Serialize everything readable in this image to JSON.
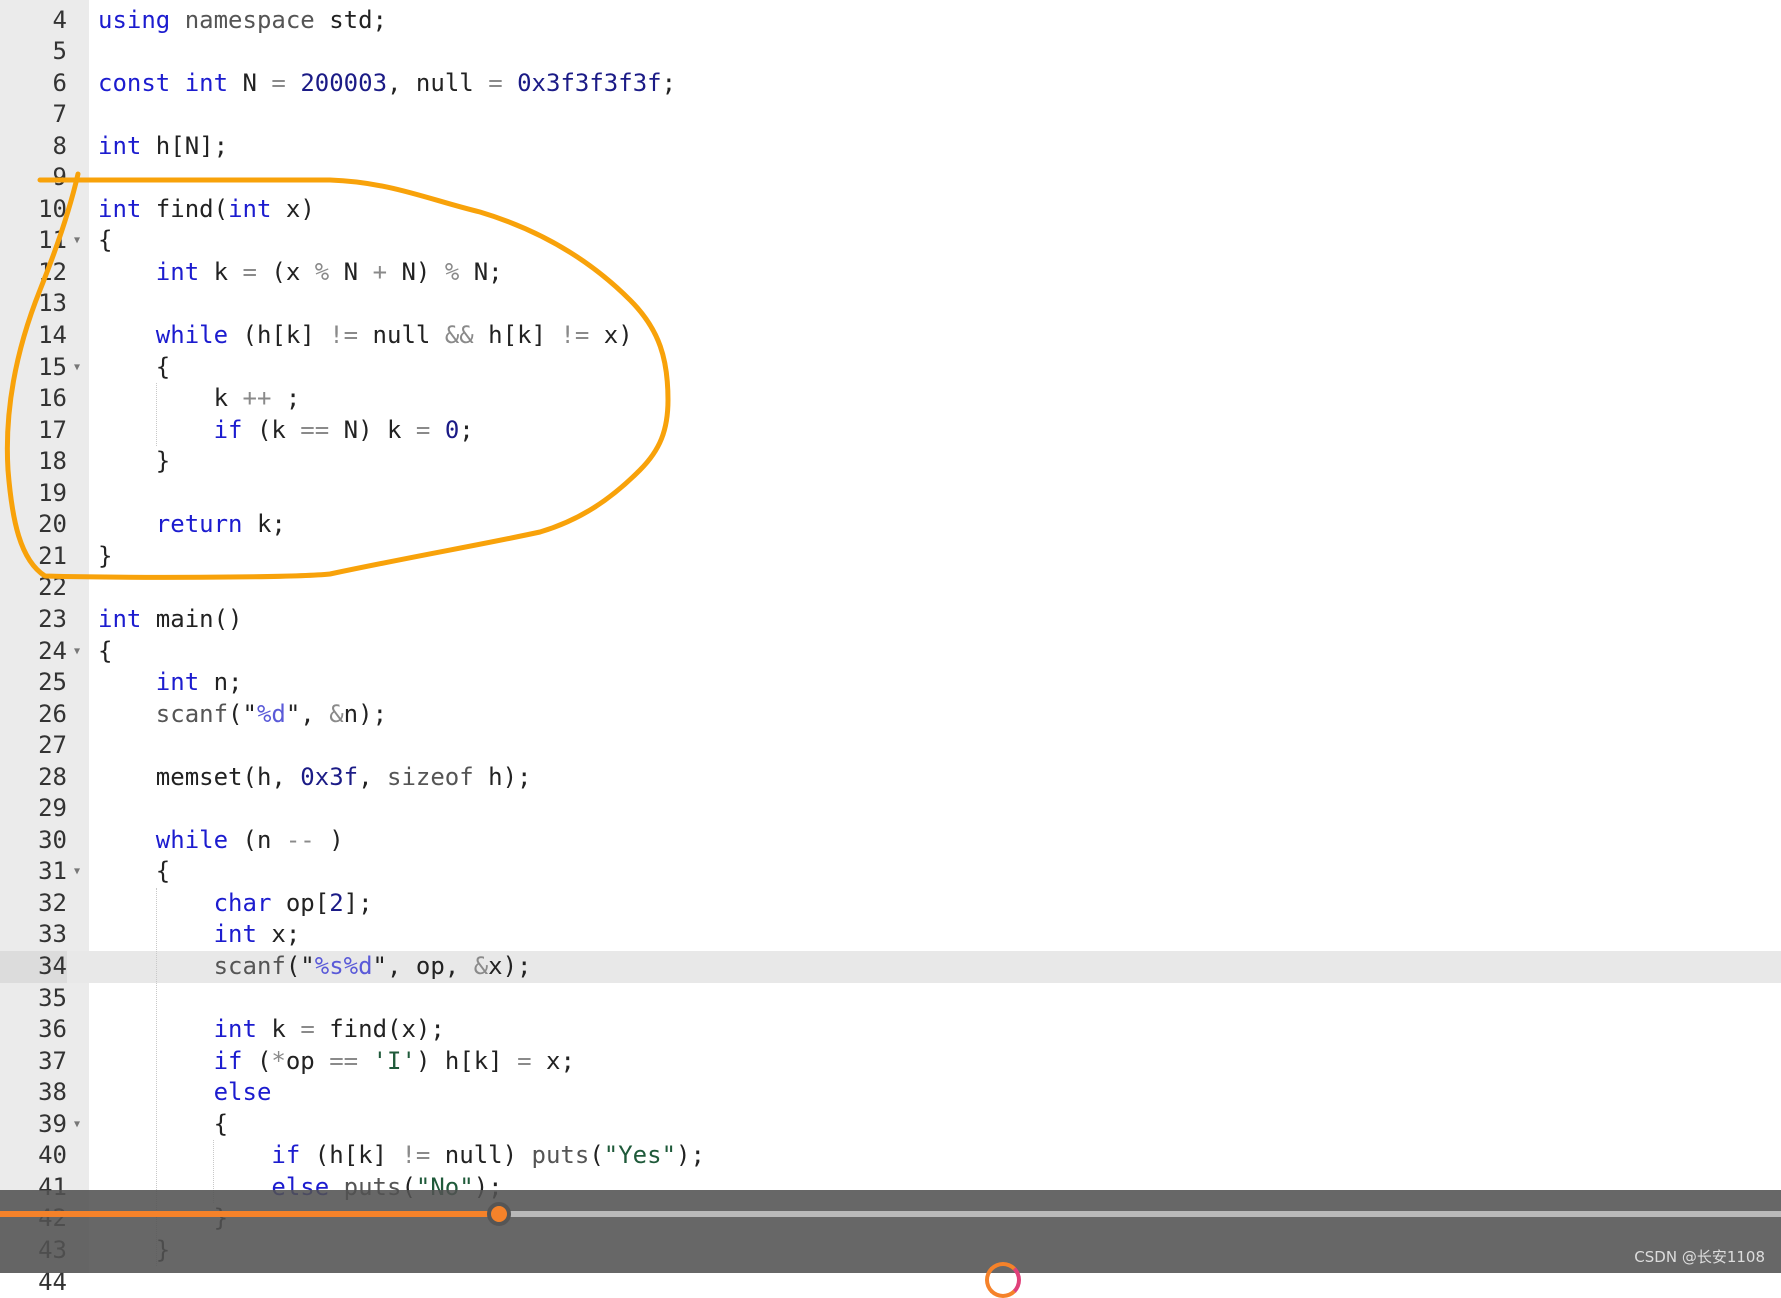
{
  "editor": {
    "active_line": 34,
    "fold_lines": [
      11,
      15,
      24,
      31,
      39
    ],
    "lines": [
      {
        "n": "4",
        "t": [
          [
            "k",
            "using"
          ],
          [
            "f",
            " namespace"
          ],
          [
            "p",
            " std;"
          ]
        ]
      },
      {
        "n": "5",
        "t": []
      },
      {
        "n": "6",
        "t": [
          [
            "k",
            "const"
          ],
          [
            "p",
            " "
          ],
          [
            "k",
            "int"
          ],
          [
            "p",
            " N "
          ],
          [
            "o",
            "="
          ],
          [
            "p",
            " "
          ],
          [
            "n",
            "200003"
          ],
          [
            "p",
            ", null "
          ],
          [
            "o",
            "="
          ],
          [
            "p",
            " "
          ],
          [
            "n",
            "0x3f3f3f3f"
          ],
          [
            "p",
            ";"
          ]
        ]
      },
      {
        "n": "7",
        "t": []
      },
      {
        "n": "8",
        "t": [
          [
            "k",
            "int"
          ],
          [
            "p",
            " h[N];"
          ]
        ]
      },
      {
        "n": "9",
        "t": []
      },
      {
        "n": "10",
        "t": [
          [
            "k",
            "int"
          ],
          [
            "p",
            " find("
          ],
          [
            "k",
            "int"
          ],
          [
            "p",
            " x)"
          ]
        ]
      },
      {
        "n": "11",
        "t": [
          [
            "p",
            "{"
          ]
        ]
      },
      {
        "n": "12",
        "t": [
          [
            "p",
            "    "
          ],
          [
            "k",
            "int"
          ],
          [
            "p",
            " k "
          ],
          [
            "o",
            "="
          ],
          [
            "p",
            " (x "
          ],
          [
            "o",
            "%"
          ],
          [
            "p",
            " N "
          ],
          [
            "o",
            "+"
          ],
          [
            "p",
            " N) "
          ],
          [
            "o",
            "%"
          ],
          [
            "p",
            " N;"
          ]
        ]
      },
      {
        "n": "13",
        "t": []
      },
      {
        "n": "14",
        "t": [
          [
            "p",
            "    "
          ],
          [
            "k",
            "while"
          ],
          [
            "p",
            " (h[k] "
          ],
          [
            "o",
            "!="
          ],
          [
            "p",
            " null "
          ],
          [
            "o",
            "&&"
          ],
          [
            "p",
            " h[k] "
          ],
          [
            "o",
            "!="
          ],
          [
            "p",
            " x)"
          ]
        ]
      },
      {
        "n": "15",
        "t": [
          [
            "p",
            "    {"
          ]
        ]
      },
      {
        "n": "16",
        "t": [
          [
            "p",
            "        k "
          ],
          [
            "o",
            "++"
          ],
          [
            "p",
            " ;"
          ]
        ]
      },
      {
        "n": "17",
        "t": [
          [
            "p",
            "        "
          ],
          [
            "k",
            "if"
          ],
          [
            "p",
            " (k "
          ],
          [
            "o",
            "=="
          ],
          [
            "p",
            " N) k "
          ],
          [
            "o",
            "="
          ],
          [
            "p",
            " "
          ],
          [
            "n",
            "0"
          ],
          [
            "p",
            ";"
          ]
        ]
      },
      {
        "n": "18",
        "t": [
          [
            "p",
            "    }"
          ]
        ]
      },
      {
        "n": "19",
        "t": []
      },
      {
        "n": "20",
        "t": [
          [
            "p",
            "    "
          ],
          [
            "k",
            "return"
          ],
          [
            "p",
            " k;"
          ]
        ]
      },
      {
        "n": "21",
        "t": [
          [
            "p",
            "}"
          ]
        ]
      },
      {
        "n": "22",
        "t": []
      },
      {
        "n": "23",
        "t": [
          [
            "k",
            "int"
          ],
          [
            "p",
            " main()"
          ]
        ]
      },
      {
        "n": "24",
        "t": [
          [
            "p",
            "{"
          ]
        ]
      },
      {
        "n": "25",
        "t": [
          [
            "p",
            "    "
          ],
          [
            "k",
            "int"
          ],
          [
            "p",
            " n;"
          ]
        ]
      },
      {
        "n": "26",
        "t": [
          [
            "p",
            "    "
          ],
          [
            "f",
            "scanf"
          ],
          [
            "p",
            "(\""
          ],
          [
            "s2",
            "%d"
          ],
          [
            "p",
            "\", "
          ],
          [
            "o",
            "&"
          ],
          [
            "p",
            "n);"
          ]
        ]
      },
      {
        "n": "27",
        "t": []
      },
      {
        "n": "28",
        "t": [
          [
            "p",
            "    memset(h, "
          ],
          [
            "n",
            "0x3f"
          ],
          [
            "p",
            ", "
          ],
          [
            "f",
            "sizeof"
          ],
          [
            "p",
            " h);"
          ]
        ]
      },
      {
        "n": "29",
        "t": []
      },
      {
        "n": "30",
        "t": [
          [
            "p",
            "    "
          ],
          [
            "k",
            "while"
          ],
          [
            "p",
            " (n "
          ],
          [
            "o",
            "--"
          ],
          [
            "p",
            " )"
          ]
        ]
      },
      {
        "n": "31",
        "t": [
          [
            "p",
            "    {"
          ]
        ]
      },
      {
        "n": "32",
        "t": [
          [
            "p",
            "        "
          ],
          [
            "k",
            "char"
          ],
          [
            "p",
            " op["
          ],
          [
            "n",
            "2"
          ],
          [
            "p",
            "];"
          ]
        ]
      },
      {
        "n": "33",
        "t": [
          [
            "p",
            "        "
          ],
          [
            "k",
            "int"
          ],
          [
            "p",
            " x;"
          ]
        ]
      },
      {
        "n": "34",
        "t": [
          [
            "p",
            "        "
          ],
          [
            "f",
            "scanf"
          ],
          [
            "p",
            "(\""
          ],
          [
            "s2",
            "%s%d"
          ],
          [
            "p",
            "\", op, "
          ],
          [
            "o",
            "&"
          ],
          [
            "p",
            "x);"
          ]
        ]
      },
      {
        "n": "35",
        "t": []
      },
      {
        "n": "36",
        "t": [
          [
            "p",
            "        "
          ],
          [
            "k",
            "int"
          ],
          [
            "p",
            " k "
          ],
          [
            "o",
            "="
          ],
          [
            "p",
            " find(x);"
          ]
        ]
      },
      {
        "n": "37",
        "t": [
          [
            "p",
            "        "
          ],
          [
            "k",
            "if"
          ],
          [
            "p",
            " ("
          ],
          [
            "o",
            "*"
          ],
          [
            "p",
            "op "
          ],
          [
            "o",
            "=="
          ],
          [
            "p",
            " "
          ],
          [
            "s",
            "'I'"
          ],
          [
            "p",
            ") h[k] "
          ],
          [
            "o",
            "="
          ],
          [
            "p",
            " x;"
          ]
        ]
      },
      {
        "n": "38",
        "t": [
          [
            "p",
            "        "
          ],
          [
            "k",
            "else"
          ]
        ]
      },
      {
        "n": "39",
        "t": [
          [
            "p",
            "        {"
          ]
        ]
      },
      {
        "n": "40",
        "t": [
          [
            "p",
            "            "
          ],
          [
            "k",
            "if"
          ],
          [
            "p",
            " (h[k] "
          ],
          [
            "o",
            "!="
          ],
          [
            "p",
            " null) "
          ],
          [
            "f",
            "puts"
          ],
          [
            "p",
            "("
          ],
          [
            "s",
            "\"Yes\""
          ],
          [
            "p",
            ");"
          ]
        ]
      },
      {
        "n": "41",
        "t": [
          [
            "p",
            "            "
          ],
          [
            "k",
            "else"
          ],
          [
            "p",
            " "
          ],
          [
            "f",
            "puts"
          ],
          [
            "p",
            "("
          ],
          [
            "s",
            "\"No\""
          ],
          [
            "p",
            ");"
          ]
        ]
      },
      {
        "n": "42",
        "t": [
          [
            "p",
            "        }"
          ]
        ]
      },
      {
        "n": "43",
        "t": [
          [
            "p",
            "    }"
          ]
        ]
      },
      {
        "n": "44",
        "t": []
      }
    ]
  },
  "annotation": {
    "color": "#f8a20a"
  },
  "player": {
    "progress_percent": 28,
    "played_color": "#f5822a",
    "watermark": "CSDN @长安1108"
  }
}
